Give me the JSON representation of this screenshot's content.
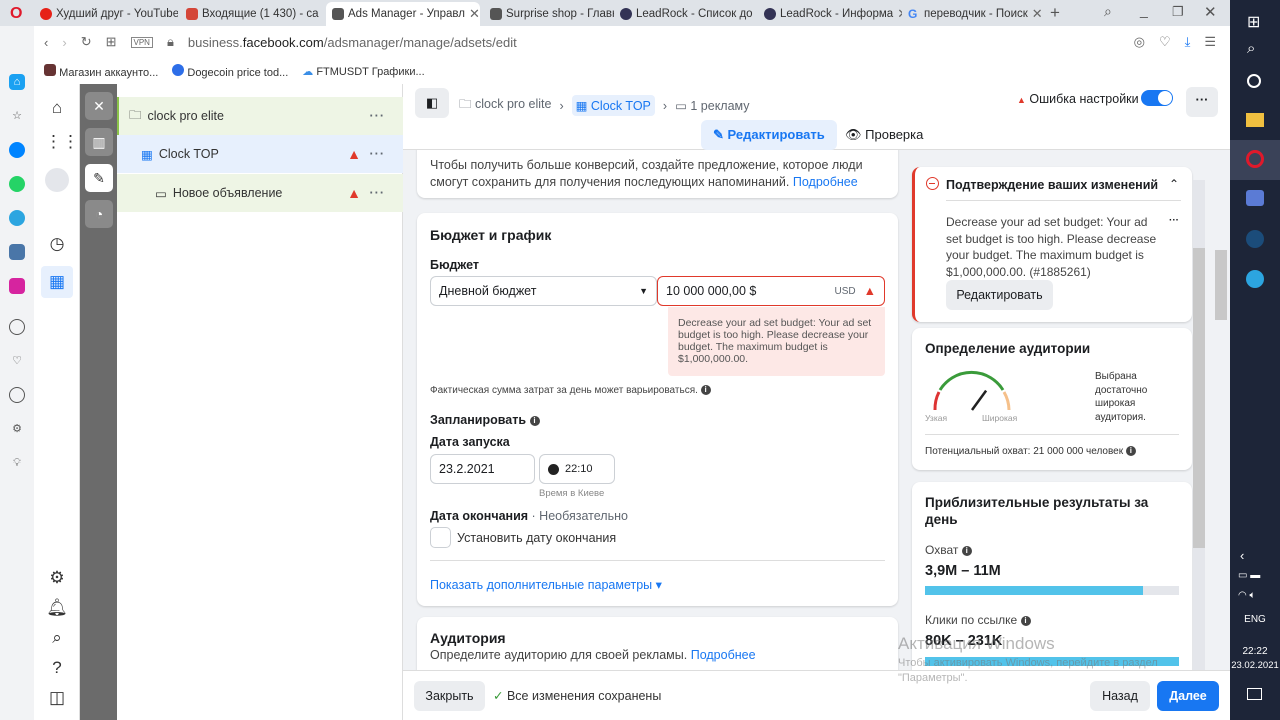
{
  "browser": {
    "tabs": [
      {
        "title": "Худший друг - YouTube",
        "color": "#e62117"
      },
      {
        "title": "Входящие (1 430) - са",
        "color": "#d44638"
      },
      {
        "title": "Ads Manager - Управл",
        "color": "#555"
      },
      {
        "title": "Surprise shop - Главн",
        "color": "#555"
      },
      {
        "title": "LeadRock - Список до",
        "color": "#335"
      },
      {
        "title": "LeadRock - Информа",
        "color": "#335"
      },
      {
        "title": "переводчик - Поиск",
        "color": "#4285f4"
      }
    ],
    "vpn": "VPN",
    "url_prefix": "business.",
    "url_domain": "facebook.com",
    "url_path": "/adsmanager/manage/adsets/edit",
    "bookmarks": [
      "Магазин аккаунто...",
      "Dogecoin price tod...",
      "FTMUSDT Графики..."
    ]
  },
  "tree": {
    "campaign": "clock pro elite",
    "adset": "Clock TOP",
    "ad": "Новое объявление"
  },
  "header": {
    "crumb_campaign": "clock pro elite",
    "crumb_adset": "Clock TOP",
    "crumb_ads": "1 рекламу",
    "error_label": "Ошибка настройки",
    "edit_tab": "Редактировать",
    "review_tab": "Проверка",
    "toggle_on": true
  },
  "intro": {
    "text": "Чтобы получить больше конверсий, создайте предложение, которое люди смогут сохранить для получения последующих напоминаний.",
    "link": "Подробнее"
  },
  "budget": {
    "section_title": "Бюджет и график",
    "budget_label": "Бюджет",
    "budget_type": "Дневной бюджет",
    "amount": "10 000 000,00 $",
    "currency": "USD",
    "error": "Decrease your ad set budget: Your ad set budget is too high. Please decrease your budget. The maximum budget is $1,000,000.00.",
    "note": "Фактическая сумма затрат за день может варьироваться.",
    "schedule_label": "Запланировать",
    "start_label": "Дата запуска",
    "start_date": "23.2.2021",
    "start_time": "22:10",
    "timezone_note": "Время в Киеве",
    "end_label": "Дата окончания",
    "end_optional": "· Необязательно",
    "end_checkbox": "Установить дату окончания",
    "more_params": "Показать дополнительные параметры ▾"
  },
  "audience": {
    "title": "Аудитория",
    "desc": "Определите аудиторию для своей рекламы.",
    "link": "Подробнее"
  },
  "confirm": {
    "title": "Подтверждение ваших изменений",
    "message": "Decrease your ad set budget: Your ad set budget is too high. Please decrease your budget. The maximum budget is $1,000,000.00. (#1885261)",
    "edit_button": "Редактировать"
  },
  "audience_def": {
    "title": "Определение аудитории",
    "narrow": "Узкая",
    "wide": "Широкая",
    "status": "Выбрана достаточно широкая аудитория.",
    "reach": "Потенциальный охват: 21 000 000 человек",
    "gauge_fraction": 0.7
  },
  "results": {
    "title": "Приблизительные результаты за день",
    "reach_label": "Охват",
    "reach_value": "3,9M – 11M",
    "reach_fraction": 0.86,
    "clicks_label": "Клики по ссылке",
    "clicks_value": "80K – 231K",
    "clicks_fraction": 1.0
  },
  "footer": {
    "close": "Закрыть",
    "saved": "Все изменения сохранены",
    "back": "Назад",
    "next": "Далее"
  },
  "watermark": {
    "title": "Активация Windows",
    "text": "Чтобы активировать Windows, перейдите в раздел \"Параметры\"."
  },
  "taskbar": {
    "lang": "ENG",
    "time": "22:22",
    "date": "23.02.2021"
  }
}
